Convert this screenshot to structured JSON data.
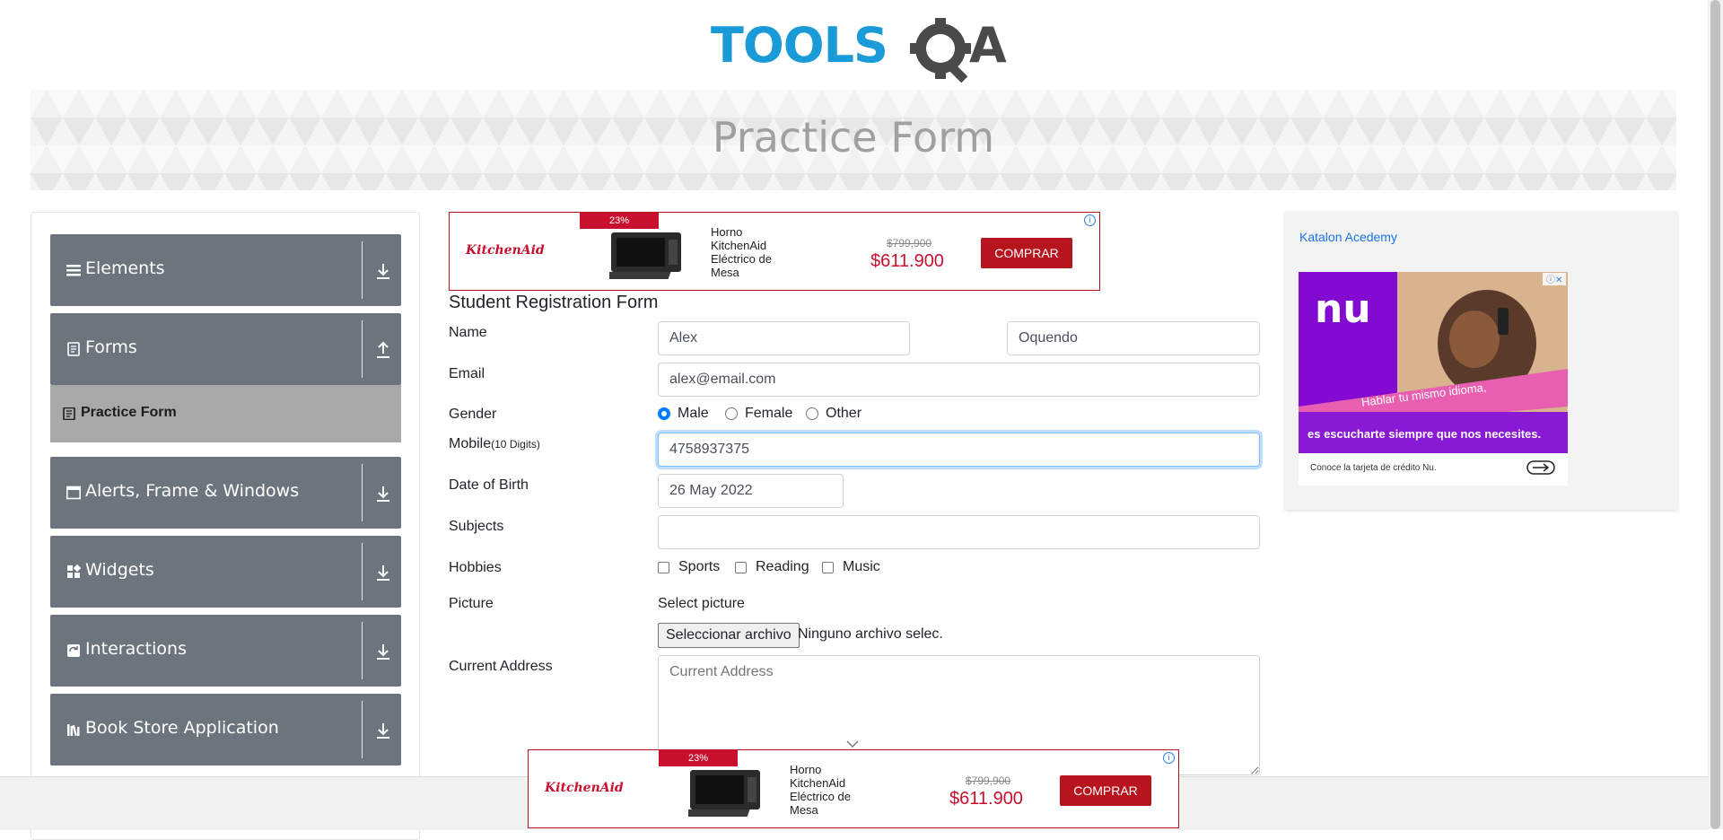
{
  "header": {
    "logo_text": "TOOLSQA",
    "page_title": "Practice Form"
  },
  "sidebar": {
    "groups": [
      {
        "label": "Elements",
        "icon": "hamburger-icon",
        "arrow": "download-icon"
      },
      {
        "label": "Forms",
        "icon": "document-icon",
        "arrow": "upload-icon"
      },
      {
        "label": "Alerts, Frame & Windows",
        "icon": "window-icon",
        "arrow": "download-icon"
      },
      {
        "label": "Widgets",
        "icon": "widgets-icon",
        "arrow": "download-icon"
      },
      {
        "label": "Interactions",
        "icon": "interactions-icon",
        "arrow": "download-icon"
      },
      {
        "label": "Book Store Application",
        "icon": "books-icon",
        "arrow": "download-icon"
      }
    ],
    "active_item": {
      "label": "Practice Form",
      "icon": "form-icon"
    }
  },
  "ad_top": {
    "brand": "KitchenAid",
    "discount": "23%",
    "product": "Horno KitchenAid Eléctrico de Mesa",
    "old_price": "$799,900",
    "price": "$611.900",
    "button": "COMPRAR",
    "info": "i"
  },
  "ad_bottom": {
    "brand": "KitchenAid",
    "discount": "23%",
    "product": "Horno KitchenAid Eléctrico de Mesa",
    "old_price": "$799,900",
    "price": "$611.900",
    "button": "COMPRAR",
    "info": "i"
  },
  "form": {
    "title": "Student Registration Form",
    "name": {
      "label": "Name",
      "first": "Alex",
      "last": "Oquendo"
    },
    "email": {
      "label": "Email",
      "value": "alex@email.com"
    },
    "gender": {
      "label": "Gender",
      "options": [
        "Male",
        "Female",
        "Other"
      ],
      "selected": "Male"
    },
    "mobile": {
      "label": "Mobile",
      "hint": "(10 Digits)",
      "value": "4758937375"
    },
    "dob": {
      "label": "Date of Birth",
      "value": "26 May 2022"
    },
    "subjects": {
      "label": "Subjects",
      "value": ""
    },
    "hobbies": {
      "label": "Hobbies",
      "options": [
        "Sports",
        "Reading",
        "Music"
      ]
    },
    "picture": {
      "label": "Picture",
      "select_text": "Select picture",
      "button": "Seleccionar archivo",
      "no_file": "Ninguno archivo selec."
    },
    "address": {
      "label": "Current Address",
      "placeholder": "Current Address"
    }
  },
  "right_ad": {
    "link_text": "Katalon Acedemy",
    "brand": "nu",
    "line1": "Hablar tu mismo idioma,",
    "line2": "es escucharte siempre que nos necesites.",
    "footer": "Conoce la tarjeta de crédito Nu."
  },
  "colors": {
    "sidebar_bg": "#6c757d",
    "active_item_bg": "#a9a9a9",
    "ad_red": "#c8102e",
    "logo_blue": "#1a9bd7",
    "logo_dark": "#4a4a4a",
    "nu_purple": "#820ad1",
    "focus_blue": "#80bdff"
  }
}
